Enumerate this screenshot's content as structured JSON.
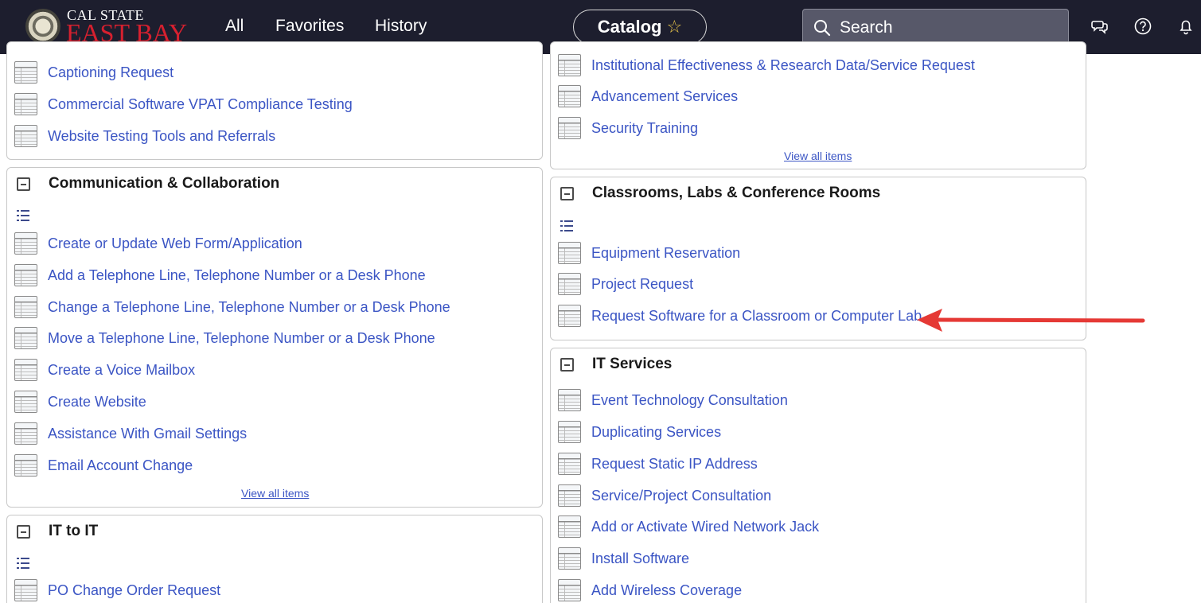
{
  "header": {
    "logo_top": "CAL STATE",
    "logo_bottom": "EAST BAY",
    "nav": [
      "All",
      "Favorites",
      "History"
    ],
    "catalog_label": "Catalog",
    "search_placeholder": "Search"
  },
  "left_column": {
    "card_top": {
      "items": [
        "Captioning Request",
        "Commercial Software VPAT Compliance Testing",
        "Website Testing Tools and Referrals"
      ]
    },
    "card_comm": {
      "title": "Communication & Collaboration",
      "items": [
        "Create or Update Web Form/Application",
        "Add a Telephone Line, Telephone Number or a Desk Phone",
        "Change a Telephone Line, Telephone Number or a Desk Phone",
        "Move a Telephone Line, Telephone Number or a Desk Phone",
        "Create a Voice Mailbox",
        "Create Website",
        "Assistance With Gmail Settings",
        "Email Account Change"
      ],
      "view_all": "View all items"
    },
    "card_itit": {
      "title": "IT to IT",
      "items": [
        "PO Change Order Request"
      ]
    }
  },
  "right_column": {
    "card_top": {
      "items": [
        "Institutional Effectiveness & Research Data/Service Request",
        "Advancement Services",
        "Security Training"
      ],
      "view_all": "View all items"
    },
    "card_classrooms": {
      "title": "Classrooms, Labs & Conference Rooms",
      "items": [
        "Equipment Reservation",
        "Project Request",
        "Request Software for a Classroom or Computer Lab"
      ]
    },
    "card_it": {
      "title": "IT Services",
      "items": [
        "Event Technology Consultation",
        "Duplicating Services",
        "Request Static IP Address",
        "Service/Project Consultation",
        "Add or Activate Wired Network Jack",
        "Install Software",
        "Add Wireless Coverage"
      ]
    }
  },
  "colors": {
    "topbar": "#1d1e2e",
    "link": "#3b55c4",
    "brand_red": "#d6202f",
    "annotation_arrow": "#e53935"
  }
}
